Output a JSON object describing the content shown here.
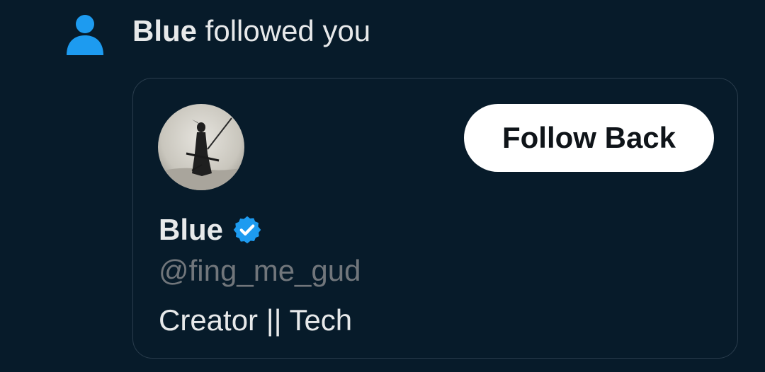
{
  "notification": {
    "actor_name": "Blue",
    "action_text": " followed you",
    "icon": "person-icon"
  },
  "profile_card": {
    "display_name": "Blue",
    "verified_icon": "verified-badge-icon",
    "handle": "@fing_me_gud",
    "bio": "Creator || Tech",
    "follow_button_label": "Follow Back"
  },
  "colors": {
    "background": "#071b2a",
    "accent_blue": "#1d9bf0",
    "primary_text": "#e7e9ea",
    "secondary_text": "#71767b",
    "card_border": "#2a3d4d",
    "button_bg": "#ffffff",
    "button_text": "#0f1419"
  }
}
